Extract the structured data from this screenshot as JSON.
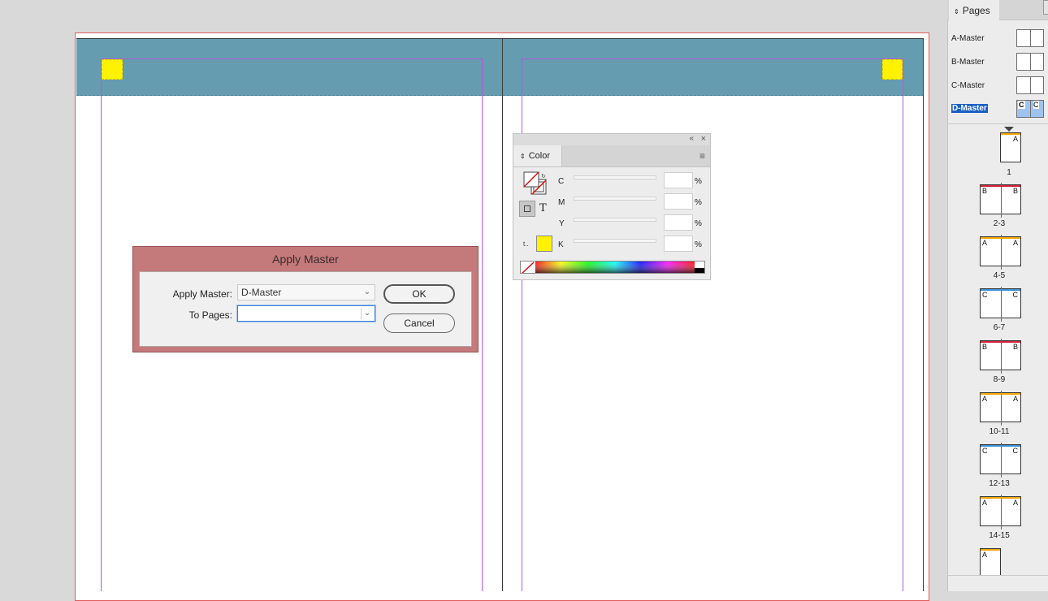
{
  "apply_master_dialog": {
    "title": "Apply Master",
    "apply_master_label": "Apply Master:",
    "apply_master_value": "D-Master",
    "to_pages_label": "To Pages:",
    "to_pages_value": "",
    "ok_label": "OK",
    "cancel_label": "Cancel"
  },
  "color_panel": {
    "tab_label": "Color",
    "channels": [
      "C",
      "M",
      "Y",
      "K"
    ],
    "percent": "%",
    "fill_color": "#fff200",
    "tint_label": "t.."
  },
  "pages_panel": {
    "tab_label": "Pages",
    "masters": [
      "A-Master",
      "B-Master",
      "C-Master",
      "D-Master"
    ],
    "selected_master": "D-Master",
    "d_master_letters": [
      "C",
      "C"
    ],
    "spreads": [
      {
        "label": "1",
        "letters": [
          "A"
        ],
        "accent": "#f2a800"
      },
      {
        "label": "2-3",
        "letters": [
          "B",
          "B"
        ],
        "accent": "#d6203a"
      },
      {
        "label": "4-5",
        "letters": [
          "A",
          "A"
        ],
        "accent": "#f2a800"
      },
      {
        "label": "6-7",
        "letters": [
          "C",
          "C"
        ],
        "accent": "#3d8fd6"
      },
      {
        "label": "8-9",
        "letters": [
          "B",
          "B"
        ],
        "accent": "#d6203a"
      },
      {
        "label": "10-11",
        "letters": [
          "A",
          "A"
        ],
        "accent": "#f2a800"
      },
      {
        "label": "12-13",
        "letters": [
          "C",
          "C"
        ],
        "accent": "#3d8fd6"
      },
      {
        "label": "14-15",
        "letters": [
          "A",
          "A"
        ],
        "accent": "#f2a800"
      },
      {
        "label": "",
        "letters": [
          "A"
        ],
        "accent": "#f2a800"
      }
    ]
  },
  "colors": {
    "header_band": "#659cb0",
    "dialog_frame": "#c47a7b",
    "selection_blue": "#1a5fc4"
  }
}
